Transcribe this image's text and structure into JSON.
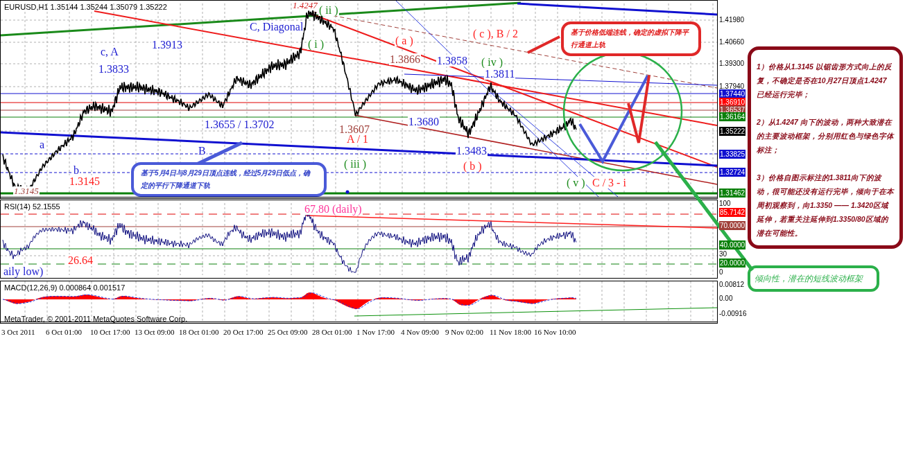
{
  "header": "EURUSD,H1  1.35144 1.35244 1.35079 1.35222",
  "wave_labels": [
    {
      "text": "1.4247",
      "color": "#d02020"
    },
    {
      "text": "( ii )",
      "color": "#1a8a1a"
    },
    {
      "text": "C, Diagonal",
      "color": "#1c1cd0"
    },
    {
      "text": "( i )",
      "color": "#1a8a1a"
    },
    {
      "text": "c, A",
      "color": "#1c1cd0"
    },
    {
      "text": "1.3913",
      "color": "#1c1cd0"
    },
    {
      "text": "1.3833",
      "color": "#1c1cd0"
    },
    {
      "text": "( a )",
      "color": "#ff2020"
    },
    {
      "text": "( c ), B / 2",
      "color": "#ff2020"
    },
    {
      "text": "1.3866",
      "color": "#a0403a"
    },
    {
      "text": "1.3858",
      "color": "#1c1cd0"
    },
    {
      "text": "( iv )",
      "color": "#1a8a1a"
    },
    {
      "text": "1.3811",
      "color": "#1c1cd0"
    },
    {
      "text": "1.3655 / 1.3702",
      "color": "#1c1cd0"
    },
    {
      "text": "1.3607",
      "color": "#a0403a"
    },
    {
      "text": "A / 1",
      "color": "#ff2020"
    },
    {
      "text": "1.3680",
      "color": "#1c1cd0"
    },
    {
      "text": "1.3483",
      "color": "#1c1cd0"
    },
    {
      "text": "a",
      "color": "#1c1cd0"
    },
    {
      "text": "B",
      "color": "#1c1cd0"
    },
    {
      "text": "b",
      "color": "#1c1cd0"
    },
    {
      "text": "( iii )",
      "color": "#1a8a1a"
    },
    {
      "text": "( b )",
      "color": "#ff2020"
    },
    {
      "text": "1.3145",
      "color": "#ff2020"
    },
    {
      "text": "1.3145",
      "color": "#a0403a"
    },
    {
      "text": "( v )",
      "color": "#1a8a1a"
    },
    {
      "text": "C / 3 - i",
      "color": "#ff2020"
    }
  ],
  "callouts": [
    "基于5月4日与8月29日顶点连线，经过5月29日低点，确定的平行下降通道下轨",
    "基于价格低端连线，确定的虚拟下降平行通道上轨"
  ],
  "price_axis": [
    {
      "text": "1.41980",
      "kind": "tick"
    },
    {
      "text": "1.40660",
      "kind": "tick"
    },
    {
      "text": "1.39300",
      "kind": "tick"
    },
    {
      "text": "1.37940",
      "kind": "tick"
    },
    {
      "text": "1.37440",
      "kind": "tag",
      "color": "#1010d0"
    },
    {
      "text": "1.36910",
      "kind": "tag",
      "color": "#ff0000"
    },
    {
      "text": "1.36537",
      "kind": "tag",
      "color": "#a0403a"
    },
    {
      "text": "1.36164",
      "kind": "tag",
      "color": "#0a800a"
    },
    {
      "text": "1.35222",
      "kind": "tag",
      "color": "#000000"
    },
    {
      "text": "1.33825",
      "kind": "tag",
      "color": "#1010d0"
    },
    {
      "text": "1.32724",
      "kind": "tag",
      "color": "#1010d0"
    },
    {
      "text": "1.31462",
      "kind": "tag",
      "color": "#0a800a"
    }
  ],
  "rsi": {
    "header": "RSI(14) 52.1555",
    "labels": [
      {
        "text": "67.80 (daily)",
        "color": "#ff3399"
      },
      {
        "text": "26.64",
        "color": "#ff2020"
      },
      {
        "text": "aily low)",
        "color": "#1c1cd0"
      }
    ],
    "axis": [
      {
        "text": "100",
        "kind": "tick"
      },
      {
        "text": "85.7142",
        "kind": "tag",
        "color": "#ff0000"
      },
      {
        "text": "70.0000",
        "kind": "tag",
        "color": "#a0403a"
      },
      {
        "text": "40.0000",
        "kind": "tag",
        "color": "#0a800a"
      },
      {
        "text": "30",
        "kind": "tick"
      },
      {
        "text": "20.0000",
        "kind": "tag",
        "color": "#0a800a"
      },
      {
        "text": "0",
        "kind": "tick"
      }
    ]
  },
  "macd": {
    "header": "MACD(12,26,9) 0.000864 0.001517",
    "copyright": "MetaTrader, © 2001-2011 MetaQuotes Software Corp.",
    "axis": [
      {
        "text": "0.00812",
        "kind": "tick"
      },
      {
        "text": "0.00",
        "kind": "tick"
      },
      {
        "text": "-0.00916",
        "kind": "tick"
      }
    ]
  },
  "time_axis": [
    "3 Oct 2011",
    "6 Oct 01:00",
    "10 Oct 17:00",
    "13 Oct 09:00",
    "18 Oct 01:00",
    "20 Oct 17:00",
    "25 Oct 09:00",
    "28 Oct 01:00",
    "1 Nov 17:00",
    "4 Nov 09:00",
    "9 Nov 02:00",
    "11 Nov 18:00",
    "16 Nov 10:00"
  ],
  "notes": {
    "main_note": [
      "1）价格从1.3145 以锯齿形方式向上的反复，不确定是否在10月27日顶点1.4247 已经运行完毕；",
      "2）从1.4247 向下的波动，两种大致潜在的主要波动框架，分别用红色与绿色字体标注；",
      "3）价格自图示标注的1.3811向下的波动，很可能还没有运行完毕，倾向于在本周初观察到，向1.3350 —— 1.3420区域延伸，若重关注延伸到1.3350/80区域的潜在可能性。"
    ],
    "tendency_note": "倾向性，潜在的短线波动框架"
  }
}
